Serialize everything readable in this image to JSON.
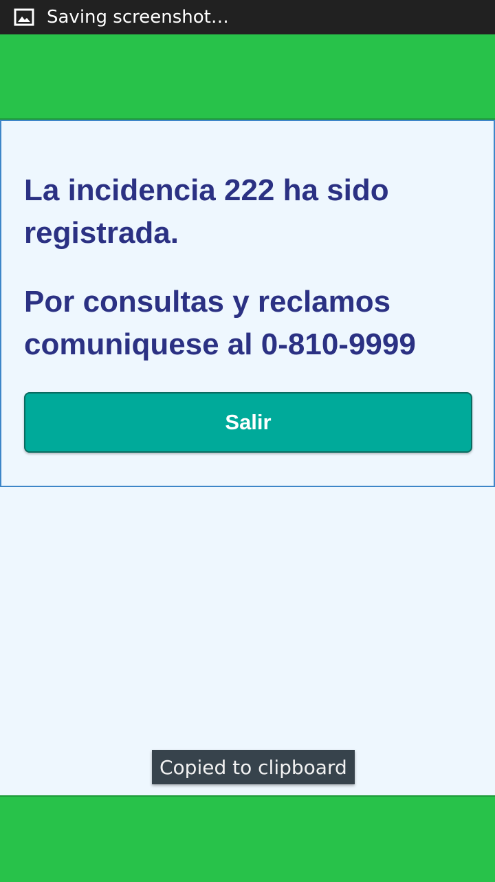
{
  "status_bar": {
    "icon": "image-icon",
    "text": "Saving screenshot…"
  },
  "main": {
    "message_registered": "La incidencia 222 ha sido registrada.",
    "message_contact": "Por consultas y reclamos comuniquese al 0-810-9999",
    "exit_label": "Salir"
  },
  "toast": {
    "text": "Copied to clipboard"
  },
  "colors": {
    "header_green": "#28c24a",
    "text_navy": "#2b3183",
    "button_teal": "#00aa9a",
    "card_border": "#3d86c8"
  }
}
